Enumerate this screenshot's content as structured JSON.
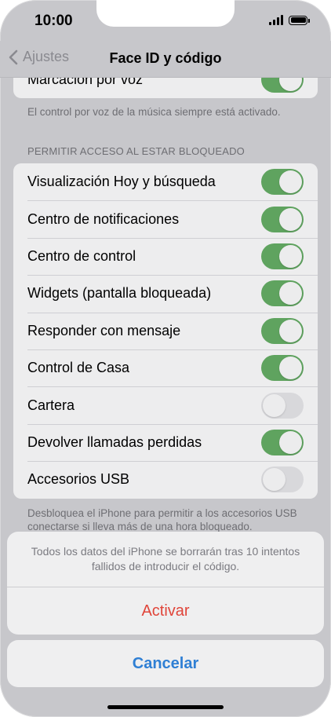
{
  "status": {
    "time": "10:00"
  },
  "nav": {
    "back_label": "Ajustes",
    "title": "Face ID y código"
  },
  "top_group": {
    "label": "Marcación por voz",
    "on": true
  },
  "voice_note": "El control por voz de la música siempre está activado.",
  "locked_section": {
    "header": "PERMITIR ACCESO AL ESTAR BLOQUEADO",
    "items": [
      {
        "label": "Visualización Hoy y búsqueda",
        "on": true
      },
      {
        "label": "Centro de notificaciones",
        "on": true
      },
      {
        "label": "Centro de control",
        "on": true
      },
      {
        "label": "Widgets (pantalla bloqueada)",
        "on": true
      },
      {
        "label": "Responder con mensaje",
        "on": true
      },
      {
        "label": "Control de Casa",
        "on": true
      },
      {
        "label": "Cartera",
        "on": false
      },
      {
        "label": "Devolver llamadas perdidas",
        "on": true
      },
      {
        "label": "Accesorios USB",
        "on": false
      }
    ],
    "footer": "Desbloquea el iPhone para permitir a los accesorios USB conectarse si lleva más de una hora bloqueado."
  },
  "action_sheet": {
    "message": "Todos los datos del iPhone se borrarán tras 10 intentos fallidos de introducir el código.",
    "destructive_label": "Activar",
    "cancel_label": "Cancelar"
  },
  "colors": {
    "toggle_on": "#5fa35f",
    "destructive": "#e0453a",
    "cancel": "#2f7fd4"
  }
}
